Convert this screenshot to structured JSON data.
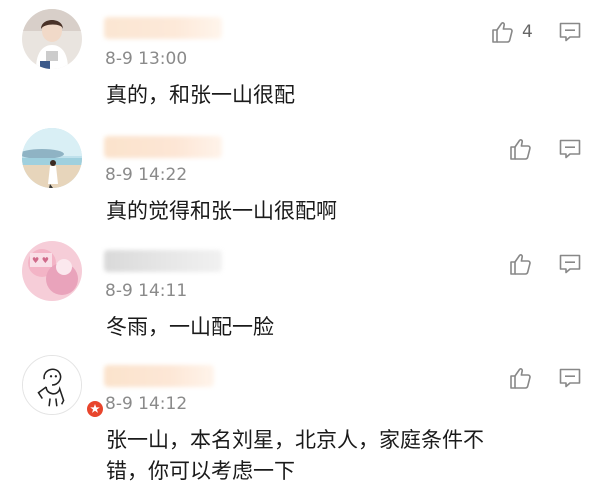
{
  "comments": [
    {
      "time": "8-9 13:00",
      "text": "真的，和张一山很配",
      "likes": "4",
      "icons": {
        "like": "thumbs-up-icon",
        "reply": "comment-bubble-icon"
      }
    },
    {
      "time": "8-9 14:22",
      "text": "真的觉得和张一山很配啊",
      "likes": "",
      "icons": {
        "like": "thumbs-up-icon",
        "reply": "comment-bubble-icon"
      }
    },
    {
      "time": "8-9 14:11",
      "text": "冬雨，一山配一脸",
      "likes": "",
      "icons": {
        "like": "thumbs-up-icon",
        "reply": "comment-bubble-icon"
      }
    },
    {
      "time": "8-9 14:12",
      "text_lines": [
        "张一山，本名刘星，北京人，家庭条件不",
        "错，你可以考虑一下"
      ],
      "likes": "",
      "verified": true,
      "icons": {
        "like": "thumbs-up-icon",
        "reply": "comment-bubble-icon",
        "badge": "verified-badge-icon"
      }
    }
  ],
  "colors": {
    "text": "#1a1a1a",
    "time": "#8a8a8a",
    "icon": "#888888",
    "badge": "#e8452c",
    "username_blur": "#fbe3cc"
  }
}
